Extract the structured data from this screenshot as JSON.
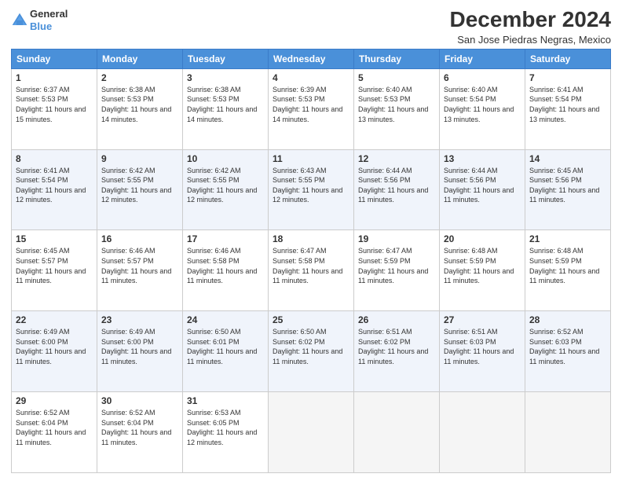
{
  "logo": {
    "general": "General",
    "blue": "Blue"
  },
  "title": "December 2024",
  "subtitle": "San Jose Piedras Negras, Mexico",
  "days_header": [
    "Sunday",
    "Monday",
    "Tuesday",
    "Wednesday",
    "Thursday",
    "Friday",
    "Saturday"
  ],
  "weeks": [
    [
      {
        "day": "1",
        "sunrise": "6:37 AM",
        "sunset": "5:53 PM",
        "daylight": "11 hours and 15 minutes."
      },
      {
        "day": "2",
        "sunrise": "6:38 AM",
        "sunset": "5:53 PM",
        "daylight": "11 hours and 14 minutes."
      },
      {
        "day": "3",
        "sunrise": "6:38 AM",
        "sunset": "5:53 PM",
        "daylight": "11 hours and 14 minutes."
      },
      {
        "day": "4",
        "sunrise": "6:39 AM",
        "sunset": "5:53 PM",
        "daylight": "11 hours and 14 minutes."
      },
      {
        "day": "5",
        "sunrise": "6:40 AM",
        "sunset": "5:53 PM",
        "daylight": "11 hours and 13 minutes."
      },
      {
        "day": "6",
        "sunrise": "6:40 AM",
        "sunset": "5:54 PM",
        "daylight": "11 hours and 13 minutes."
      },
      {
        "day": "7",
        "sunrise": "6:41 AM",
        "sunset": "5:54 PM",
        "daylight": "11 hours and 13 minutes."
      }
    ],
    [
      {
        "day": "8",
        "sunrise": "6:41 AM",
        "sunset": "5:54 PM",
        "daylight": "11 hours and 12 minutes."
      },
      {
        "day": "9",
        "sunrise": "6:42 AM",
        "sunset": "5:55 PM",
        "daylight": "11 hours and 12 minutes."
      },
      {
        "day": "10",
        "sunrise": "6:42 AM",
        "sunset": "5:55 PM",
        "daylight": "11 hours and 12 minutes."
      },
      {
        "day": "11",
        "sunrise": "6:43 AM",
        "sunset": "5:55 PM",
        "daylight": "11 hours and 12 minutes."
      },
      {
        "day": "12",
        "sunrise": "6:44 AM",
        "sunset": "5:56 PM",
        "daylight": "11 hours and 11 minutes."
      },
      {
        "day": "13",
        "sunrise": "6:44 AM",
        "sunset": "5:56 PM",
        "daylight": "11 hours and 11 minutes."
      },
      {
        "day": "14",
        "sunrise": "6:45 AM",
        "sunset": "5:56 PM",
        "daylight": "11 hours and 11 minutes."
      }
    ],
    [
      {
        "day": "15",
        "sunrise": "6:45 AM",
        "sunset": "5:57 PM",
        "daylight": "11 hours and 11 minutes."
      },
      {
        "day": "16",
        "sunrise": "6:46 AM",
        "sunset": "5:57 PM",
        "daylight": "11 hours and 11 minutes."
      },
      {
        "day": "17",
        "sunrise": "6:46 AM",
        "sunset": "5:58 PM",
        "daylight": "11 hours and 11 minutes."
      },
      {
        "day": "18",
        "sunrise": "6:47 AM",
        "sunset": "5:58 PM",
        "daylight": "11 hours and 11 minutes."
      },
      {
        "day": "19",
        "sunrise": "6:47 AM",
        "sunset": "5:59 PM",
        "daylight": "11 hours and 11 minutes."
      },
      {
        "day": "20",
        "sunrise": "6:48 AM",
        "sunset": "5:59 PM",
        "daylight": "11 hours and 11 minutes."
      },
      {
        "day": "21",
        "sunrise": "6:48 AM",
        "sunset": "5:59 PM",
        "daylight": "11 hours and 11 minutes."
      }
    ],
    [
      {
        "day": "22",
        "sunrise": "6:49 AM",
        "sunset": "6:00 PM",
        "daylight": "11 hours and 11 minutes."
      },
      {
        "day": "23",
        "sunrise": "6:49 AM",
        "sunset": "6:00 PM",
        "daylight": "11 hours and 11 minutes."
      },
      {
        "day": "24",
        "sunrise": "6:50 AM",
        "sunset": "6:01 PM",
        "daylight": "11 hours and 11 minutes."
      },
      {
        "day": "25",
        "sunrise": "6:50 AM",
        "sunset": "6:02 PM",
        "daylight": "11 hours and 11 minutes."
      },
      {
        "day": "26",
        "sunrise": "6:51 AM",
        "sunset": "6:02 PM",
        "daylight": "11 hours and 11 minutes."
      },
      {
        "day": "27",
        "sunrise": "6:51 AM",
        "sunset": "6:03 PM",
        "daylight": "11 hours and 11 minutes."
      },
      {
        "day": "28",
        "sunrise": "6:52 AM",
        "sunset": "6:03 PM",
        "daylight": "11 hours and 11 minutes."
      }
    ],
    [
      {
        "day": "29",
        "sunrise": "6:52 AM",
        "sunset": "6:04 PM",
        "daylight": "11 hours and 11 minutes."
      },
      {
        "day": "30",
        "sunrise": "6:52 AM",
        "sunset": "6:04 PM",
        "daylight": "11 hours and 11 minutes."
      },
      {
        "day": "31",
        "sunrise": "6:53 AM",
        "sunset": "6:05 PM",
        "daylight": "11 hours and 12 minutes."
      },
      null,
      null,
      null,
      null
    ]
  ]
}
